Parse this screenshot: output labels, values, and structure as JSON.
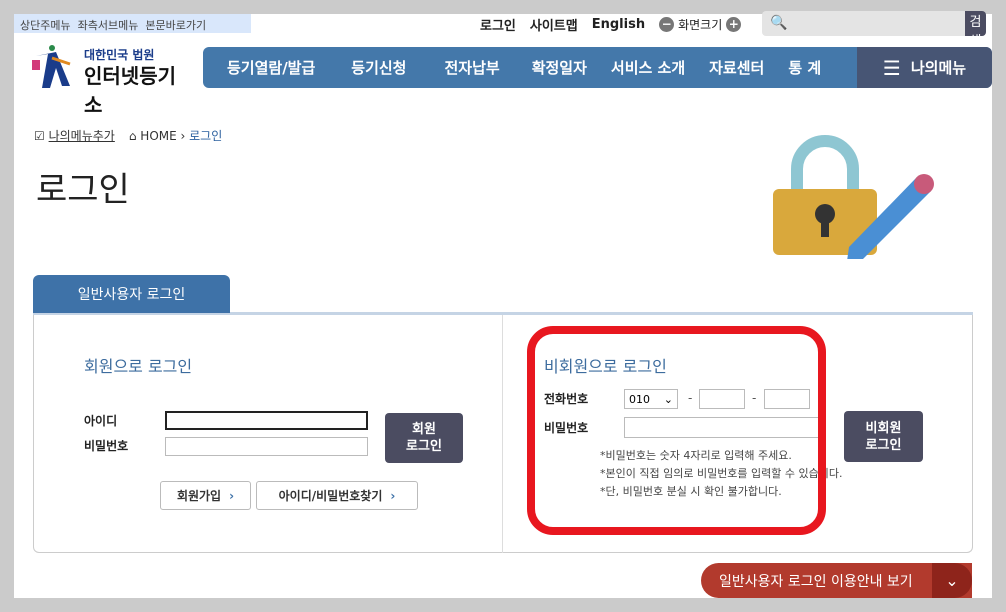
{
  "skip_links": [
    "상단주메뉴",
    "좌측서브메뉴",
    "본문바로가기"
  ],
  "util": {
    "login": "로그인",
    "sitemap": "사이트맵",
    "english": "English",
    "zoom_label": "화면크기",
    "minus": "−",
    "plus": "+"
  },
  "search": {
    "placeholder": "",
    "button": "검색"
  },
  "logo": {
    "line1": "대한민국 법원",
    "line2": "인터넷등기소"
  },
  "gnb": [
    "등기열람/발급",
    "등기신청",
    "전자납부",
    "확정일자",
    "서비스 소개",
    "자료센터",
    "통 계"
  ],
  "my_menu": "나의메뉴",
  "breadcrumb": {
    "add": "나의메뉴추가",
    "home": "HOME",
    "current": "로그인"
  },
  "page_title": "로그인",
  "tab": "일반사용자 로그인",
  "member": {
    "title": "회원으로 로그인",
    "id_label": "아이디",
    "pw_label": "비밀번호",
    "login_btn_1": "회원",
    "login_btn_2": "로그인",
    "join": "회원가입",
    "find": "아이디/비밀번호찾기"
  },
  "guest": {
    "title": "비회원으로 로그인",
    "phone_label": "전화번호",
    "phone_prefix": "010",
    "pw_label": "비밀번호",
    "login_btn_1": "비회원",
    "login_btn_2": "로그인",
    "notes": [
      "*비밀번호는 숫자 4자리로 입력해 주세요.",
      "*본인이 직접 임의로 비밀번호를 입력할 수 있습니다.",
      "*단, 비밀번호 분실 시 확인 불가합니다."
    ]
  },
  "guide_button": "일반사용자 로그인 이용안내 보기",
  "colors": {
    "nav": "#4478aa",
    "mymenu": "#475574",
    "highlight": "#e8171f",
    "guide": "#b23a2d"
  }
}
